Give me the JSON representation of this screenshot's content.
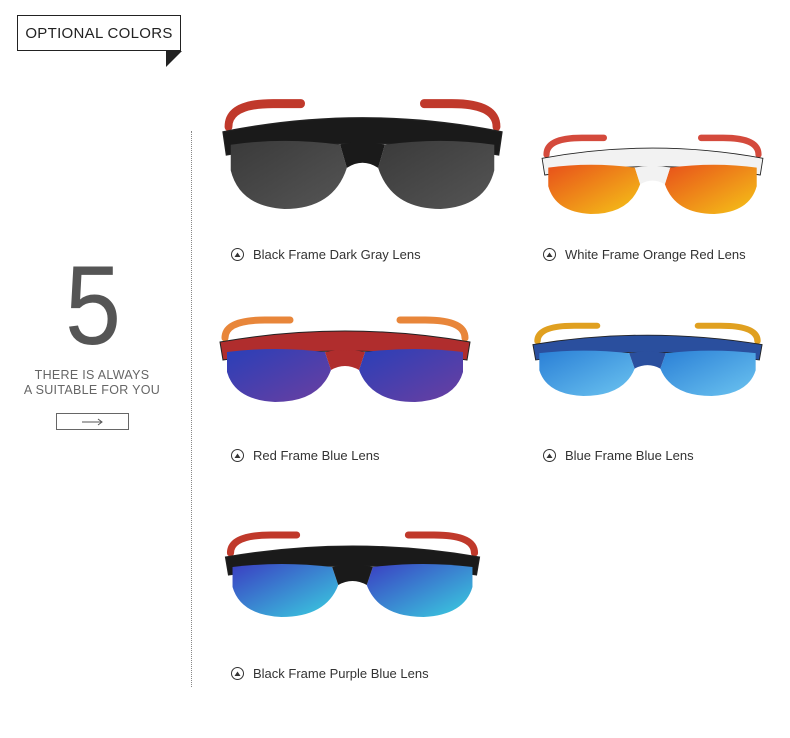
{
  "header": {
    "title": "OPTIONAL COLORS"
  },
  "sidebar": {
    "number": "5",
    "tagline_line1": "THERE IS ALWAYS",
    "tagline_line2": "A SUITABLE FOR YOU",
    "arrow_icon": "arrow-right-icon"
  },
  "products": [
    {
      "label": "Black Frame Dark Gray Lens",
      "frame_color": "#1a1a1a",
      "lens_color": "#3a3a3a",
      "lens_color2": "#555555",
      "temple_color": "#c0392b"
    },
    {
      "label": "White Frame Orange Red Lens",
      "frame_color": "#f2f2f2",
      "lens_color": "#e8501a",
      "lens_color2": "#f5c518",
      "temple_color": "#d44a3c"
    },
    {
      "label": "Red Frame Blue Lens",
      "frame_color": "#b02d2d",
      "lens_color": "#2a3fb8",
      "lens_color2": "#6b3fa0",
      "temple_color": "#e8863a"
    },
    {
      "label": "Blue Frame Blue Lens",
      "frame_color": "#2a4f9e",
      "lens_color": "#2a7fd6",
      "lens_color2": "#6cc4f0",
      "temple_color": "#e0a020"
    },
    {
      "label": "Black Frame Purple Blue Lens",
      "frame_color": "#1a1a1a",
      "lens_color": "#3a3ec2",
      "lens_color2": "#3ad0e0",
      "temple_color": "#c0392b"
    }
  ]
}
